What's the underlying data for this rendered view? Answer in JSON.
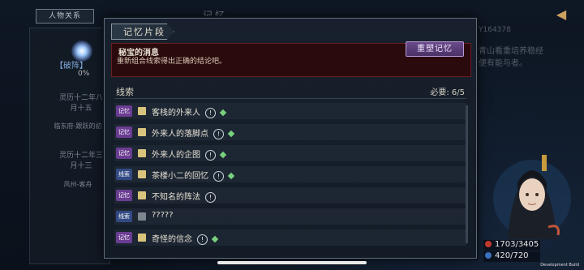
{
  "background": {
    "top_tab": "人物关系",
    "page_title": "记忆",
    "right_id": "Y164378",
    "right_text": "青山看重培养稳经便有能与者。",
    "left_panel": {
      "tag": "【破阵】",
      "percent": "0%",
      "date1": "灵历十二年八月十五",
      "loc1": "临东府-跟跃的初",
      "date2": "灵历十二年三月十三",
      "loc2": "风州-客舟"
    }
  },
  "dialog": {
    "title": "记忆片段",
    "puzzle": {
      "title": "秘宝的消息",
      "text": "重新组合线索得出正确的结论吧。",
      "reset_label": "重塑记忆"
    },
    "clues_header": "线索",
    "required": "必要: 6/5",
    "clues": [
      {
        "type": "记忆",
        "name": "客栈的外来人",
        "book": "yellow",
        "diamond": true
      },
      {
        "type": "记忆",
        "name": "外来人的落脚点",
        "book": "yellow",
        "diamond": true
      },
      {
        "type": "记忆",
        "name": "外来人的企图",
        "book": "yellow",
        "diamond": true
      },
      {
        "type": "线索",
        "name": "茶楼小二的回忆",
        "book": "yellow",
        "diamond": true
      },
      {
        "type": "记忆",
        "name": "不知名的阵法",
        "book": "yellow",
        "diamond": false
      },
      {
        "type": "线索",
        "name": "?????",
        "book": "gray",
        "diamond": false
      },
      {
        "type": "记忆",
        "name": "奇怪的信念",
        "book": "yellow",
        "diamond": true
      }
    ]
  },
  "stats": {
    "hp": "1703/3405",
    "mp": "420/720"
  },
  "build_label": "Development Build",
  "colors": {
    "memory_tag": "#6b3d92",
    "clue_tag": "#324a83",
    "accent_gold": "#c9a25e",
    "diamond_green": "#79d07f"
  }
}
